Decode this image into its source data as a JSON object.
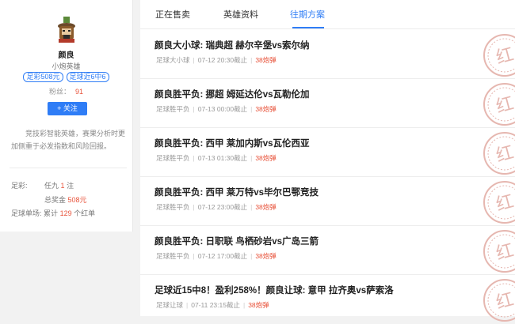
{
  "profile": {
    "name": "颜良",
    "subtitle": "小炮英雄",
    "tags": [
      "足彩508元",
      "足球近6中6"
    ],
    "fans_label": "粉丝：",
    "fans_count": "91",
    "follow_label": "+ 关注",
    "description": "竞技彩智能英雄，赛果分析时更加侧重于必发指数和风险回报。"
  },
  "stats": {
    "zucai_label": "足彩:",
    "renjiu_text": "任九",
    "renjiu_count": "1",
    "renjiu_unit": "注",
    "prize_label": "总奖金",
    "prize_value": "508元",
    "single_label": "足球单场:",
    "single_prefix": "累计",
    "single_count": "129",
    "single_suffix": "个红单"
  },
  "tabs": [
    "正在售卖",
    "英雄资料",
    "往期方案"
  ],
  "active_tab": "往期方案",
  "items": [
    {
      "title": "颜良大小球: 瑞典超 赫尔辛堡vs索尔纳",
      "category": "足球大小球",
      "time": "07-12 20:30截止",
      "price": "38炮弹"
    },
    {
      "title": "颜良胜平负: 挪超 姆延达伦vs瓦勒伦加",
      "category": "足球胜平负",
      "time": "07-13 00:00截止",
      "price": "38炮弹"
    },
    {
      "title": "颜良胜平负: 西甲 莱加内斯vs瓦伦西亚",
      "category": "足球胜平负",
      "time": "07-13 01:30截止",
      "price": "38炮弹"
    },
    {
      "title": "颜良胜平负: 西甲 莱万特vs毕尔巴鄂竞技",
      "category": "足球胜平负",
      "time": "07-12 23:00截止",
      "price": "38炮弹"
    },
    {
      "title": "颜良胜平负: 日职联 鸟栖砂岩vs广岛三箭",
      "category": "足球胜平负",
      "time": "07-12 17:00截止",
      "price": "38炮弹"
    },
    {
      "title": "足球近15中8！盈利258%！颜良让球: 意甲 拉齐奥vs萨索洛",
      "category": "足球让球",
      "time": "07-11 23:15截止",
      "price": "38炮弹"
    }
  ],
  "stamp_text": "红",
  "colors": {
    "accent": "#2f7df6",
    "price": "#e8543c",
    "stamp": "#e6b7b0"
  }
}
